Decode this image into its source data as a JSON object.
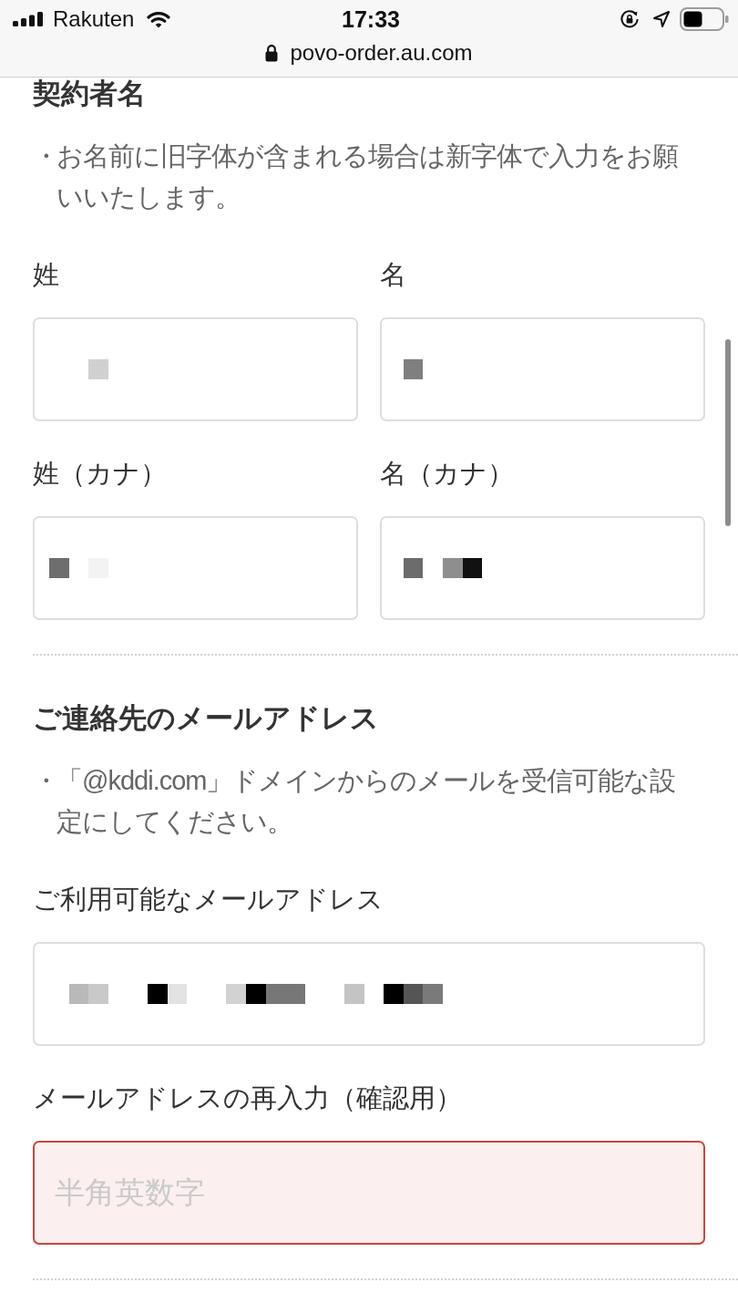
{
  "status_bar": {
    "carrier": "Rakuten",
    "time": "17:33"
  },
  "address_bar": {
    "url": "povo-order.au.com"
  },
  "sections": [
    {
      "heading": "契約者名",
      "note": {
        "bullet": "・",
        "text": "お名前に旧字体が含まれる場合は新字体で入力をお願いいたします。"
      },
      "rows": [
        [
          {
            "label": "姓",
            "kind": "masked",
            "error": false
          },
          {
            "label": "名",
            "kind": "masked",
            "error": false
          }
        ],
        [
          {
            "label": "姓（カナ）",
            "kind": "masked",
            "error": false
          },
          {
            "label": "名（カナ）",
            "kind": "masked",
            "error": false
          }
        ]
      ]
    },
    {
      "heading": "ご連絡先のメールアドレス",
      "note": {
        "bullet": "・",
        "text": "「@kddi.com」ドメインからのメールを受信可能な設定にしてください。"
      },
      "rows": [
        [
          {
            "label": "ご利用可能なメールアドレス",
            "kind": "masked",
            "error": false
          }
        ],
        [
          {
            "label": "メールアドレスの再入力（確認用）",
            "kind": "empty",
            "error": true,
            "placeholder": "半角英数字"
          }
        ]
      ]
    }
  ]
}
